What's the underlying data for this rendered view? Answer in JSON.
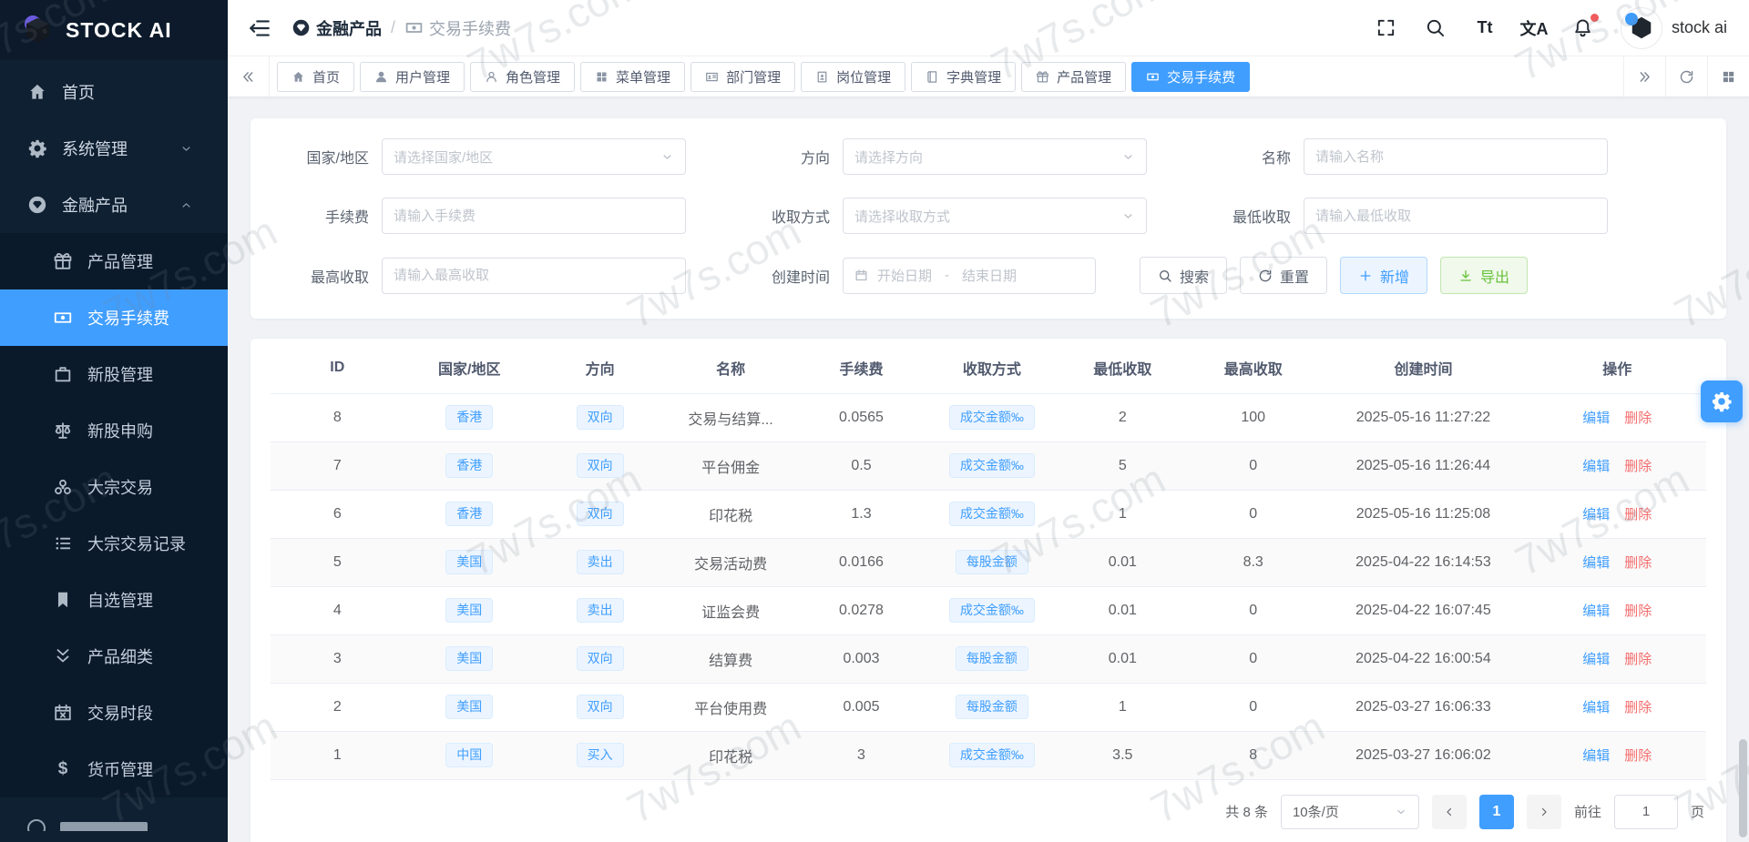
{
  "brand": {
    "name": "STOCK AI"
  },
  "watermark": "7w7s.com",
  "colors": {
    "primary": "#409eff",
    "danger": "#f56c6c",
    "success": "#67c23a",
    "sidebar_bg": "#0f2032",
    "submenu_bg": "#0a1a2b",
    "content_bg": "#f0f2f5",
    "tag_bg": "#ecf5ff"
  },
  "sidebar": {
    "items": [
      {
        "label": "首页",
        "icon": "home-icon",
        "type": "item"
      },
      {
        "label": "系统管理",
        "icon": "gear-icon",
        "type": "group",
        "chevron": "down"
      },
      {
        "label": "金融产品",
        "icon": "diamond-icon",
        "type": "group",
        "chevron": "up",
        "children": [
          {
            "label": "产品管理",
            "icon": "gift-icon"
          },
          {
            "label": "交易手续费",
            "icon": "banknote-icon",
            "active": true
          },
          {
            "label": "新股管理",
            "icon": "briefcase-icon"
          },
          {
            "label": "新股申购",
            "icon": "scales-icon"
          },
          {
            "label": "大宗交易",
            "icon": "biohazard-icon"
          },
          {
            "label": "大宗交易记录",
            "icon": "list-icon"
          },
          {
            "label": "自选管理",
            "icon": "bookmark-icon"
          },
          {
            "label": "产品细类",
            "icon": "double-chevron-down-icon"
          },
          {
            "label": "交易时段",
            "icon": "calendar-x-icon"
          },
          {
            "label": "货币管理",
            "icon": "dollar-icon",
            "glyph": "$"
          }
        ]
      }
    ]
  },
  "header": {
    "breadcrumb": [
      {
        "label": "金融产品",
        "icon": "diamond-icon"
      },
      {
        "label": "交易手续费",
        "icon": "banknote-icon"
      }
    ],
    "separator": "/",
    "actions": [
      {
        "icon": "fullscreen-icon"
      },
      {
        "icon": "search-icon"
      },
      {
        "icon": "font-size-icon",
        "glyph": "Tt"
      },
      {
        "icon": "translate-icon",
        "glyph": "文A"
      },
      {
        "icon": "bell-icon",
        "dot": true
      }
    ],
    "username": "stock ai"
  },
  "tabs": {
    "items": [
      {
        "label": "首页",
        "icon": "home-icon"
      },
      {
        "label": "用户管理",
        "icon": "user-filled-icon"
      },
      {
        "label": "角色管理",
        "icon": "user-outline-icon"
      },
      {
        "label": "菜单管理",
        "icon": "grid-icon"
      },
      {
        "label": "部门管理",
        "icon": "idcard-icon"
      },
      {
        "label": "岗位管理",
        "icon": "badge-icon"
      },
      {
        "label": "字典管理",
        "icon": "book-icon"
      },
      {
        "label": "产品管理",
        "icon": "gift-icon"
      },
      {
        "label": "交易手续费",
        "icon": "banknote-icon",
        "active": true
      }
    ]
  },
  "filters": {
    "rows": [
      [
        {
          "label": "国家/地区",
          "type": "select",
          "placeholder": "请选择国家/地区"
        },
        {
          "label": "方向",
          "type": "select",
          "placeholder": "请选择方向"
        },
        {
          "label": "名称",
          "type": "input",
          "placeholder": "请输入名称"
        }
      ],
      [
        {
          "label": "手续费",
          "type": "input",
          "placeholder": "请输入手续费"
        },
        {
          "label": "收取方式",
          "type": "select",
          "placeholder": "请选择收取方式"
        },
        {
          "label": "最低收取",
          "type": "input",
          "placeholder": "请输入最低收取"
        }
      ],
      [
        {
          "label": "最高收取",
          "type": "input",
          "placeholder": "请输入最高收取"
        },
        {
          "label": "创建时间",
          "type": "daterange",
          "start_placeholder": "开始日期",
          "separator": "-",
          "end_placeholder": "结束日期"
        }
      ]
    ],
    "buttons": [
      {
        "label": "搜索",
        "icon": "search-icon",
        "style": "default"
      },
      {
        "label": "重置",
        "icon": "refresh-icon",
        "style": "default"
      },
      {
        "label": "新增",
        "icon": "plus-icon",
        "style": "primary-light"
      },
      {
        "label": "导出",
        "icon": "download-icon",
        "style": "success-light"
      }
    ]
  },
  "table": {
    "columns": [
      "ID",
      "国家/地区",
      "方向",
      "名称",
      "手续费",
      "收取方式",
      "最低收取",
      "最高收取",
      "创建时间",
      "操作"
    ],
    "rows": [
      {
        "id": "8",
        "region": "香港",
        "direction": "双向",
        "name": "交易与结算...",
        "fee": "0.0565",
        "method": "成交金额‰",
        "min": "2",
        "max": "100",
        "created": "2025-05-16 11:27:22"
      },
      {
        "id": "7",
        "region": "香港",
        "direction": "双向",
        "name": "平台佣金",
        "fee": "0.5",
        "method": "成交金额‰",
        "min": "5",
        "max": "0",
        "created": "2025-05-16 11:26:44"
      },
      {
        "id": "6",
        "region": "香港",
        "direction": "双向",
        "name": "印花税",
        "fee": "1.3",
        "method": "成交金额‰",
        "min": "1",
        "max": "0",
        "created": "2025-05-16 11:25:08"
      },
      {
        "id": "5",
        "region": "美国",
        "direction": "卖出",
        "name": "交易活动费",
        "fee": "0.0166",
        "method": "每股金额",
        "min": "0.01",
        "max": "8.3",
        "created": "2025-04-22 16:14:53"
      },
      {
        "id": "4",
        "region": "美国",
        "direction": "卖出",
        "name": "证监会费",
        "fee": "0.0278",
        "method": "成交金额‰",
        "min": "0.01",
        "max": "0",
        "created": "2025-04-22 16:07:45"
      },
      {
        "id": "3",
        "region": "美国",
        "direction": "双向",
        "name": "结算费",
        "fee": "0.003",
        "method": "每股金额",
        "min": "0.01",
        "max": "0",
        "created": "2025-04-22 16:00:54"
      },
      {
        "id": "2",
        "region": "美国",
        "direction": "双向",
        "name": "平台使用费",
        "fee": "0.005",
        "method": "每股金额",
        "min": "1",
        "max": "0",
        "created": "2025-03-27 16:06:33"
      },
      {
        "id": "1",
        "region": "中国",
        "direction": "买入",
        "name": "印花税",
        "fee": "3",
        "method": "成交金额‰",
        "min": "3.5",
        "max": "8",
        "created": "2025-03-27 16:06:02"
      }
    ],
    "actions": {
      "edit": "编辑",
      "delete": "删除"
    }
  },
  "pagination": {
    "total": "共 8 条",
    "page_size": "10条/页",
    "current": "1",
    "goto_label": "前往",
    "goto_value": "1",
    "page_label": "页"
  }
}
